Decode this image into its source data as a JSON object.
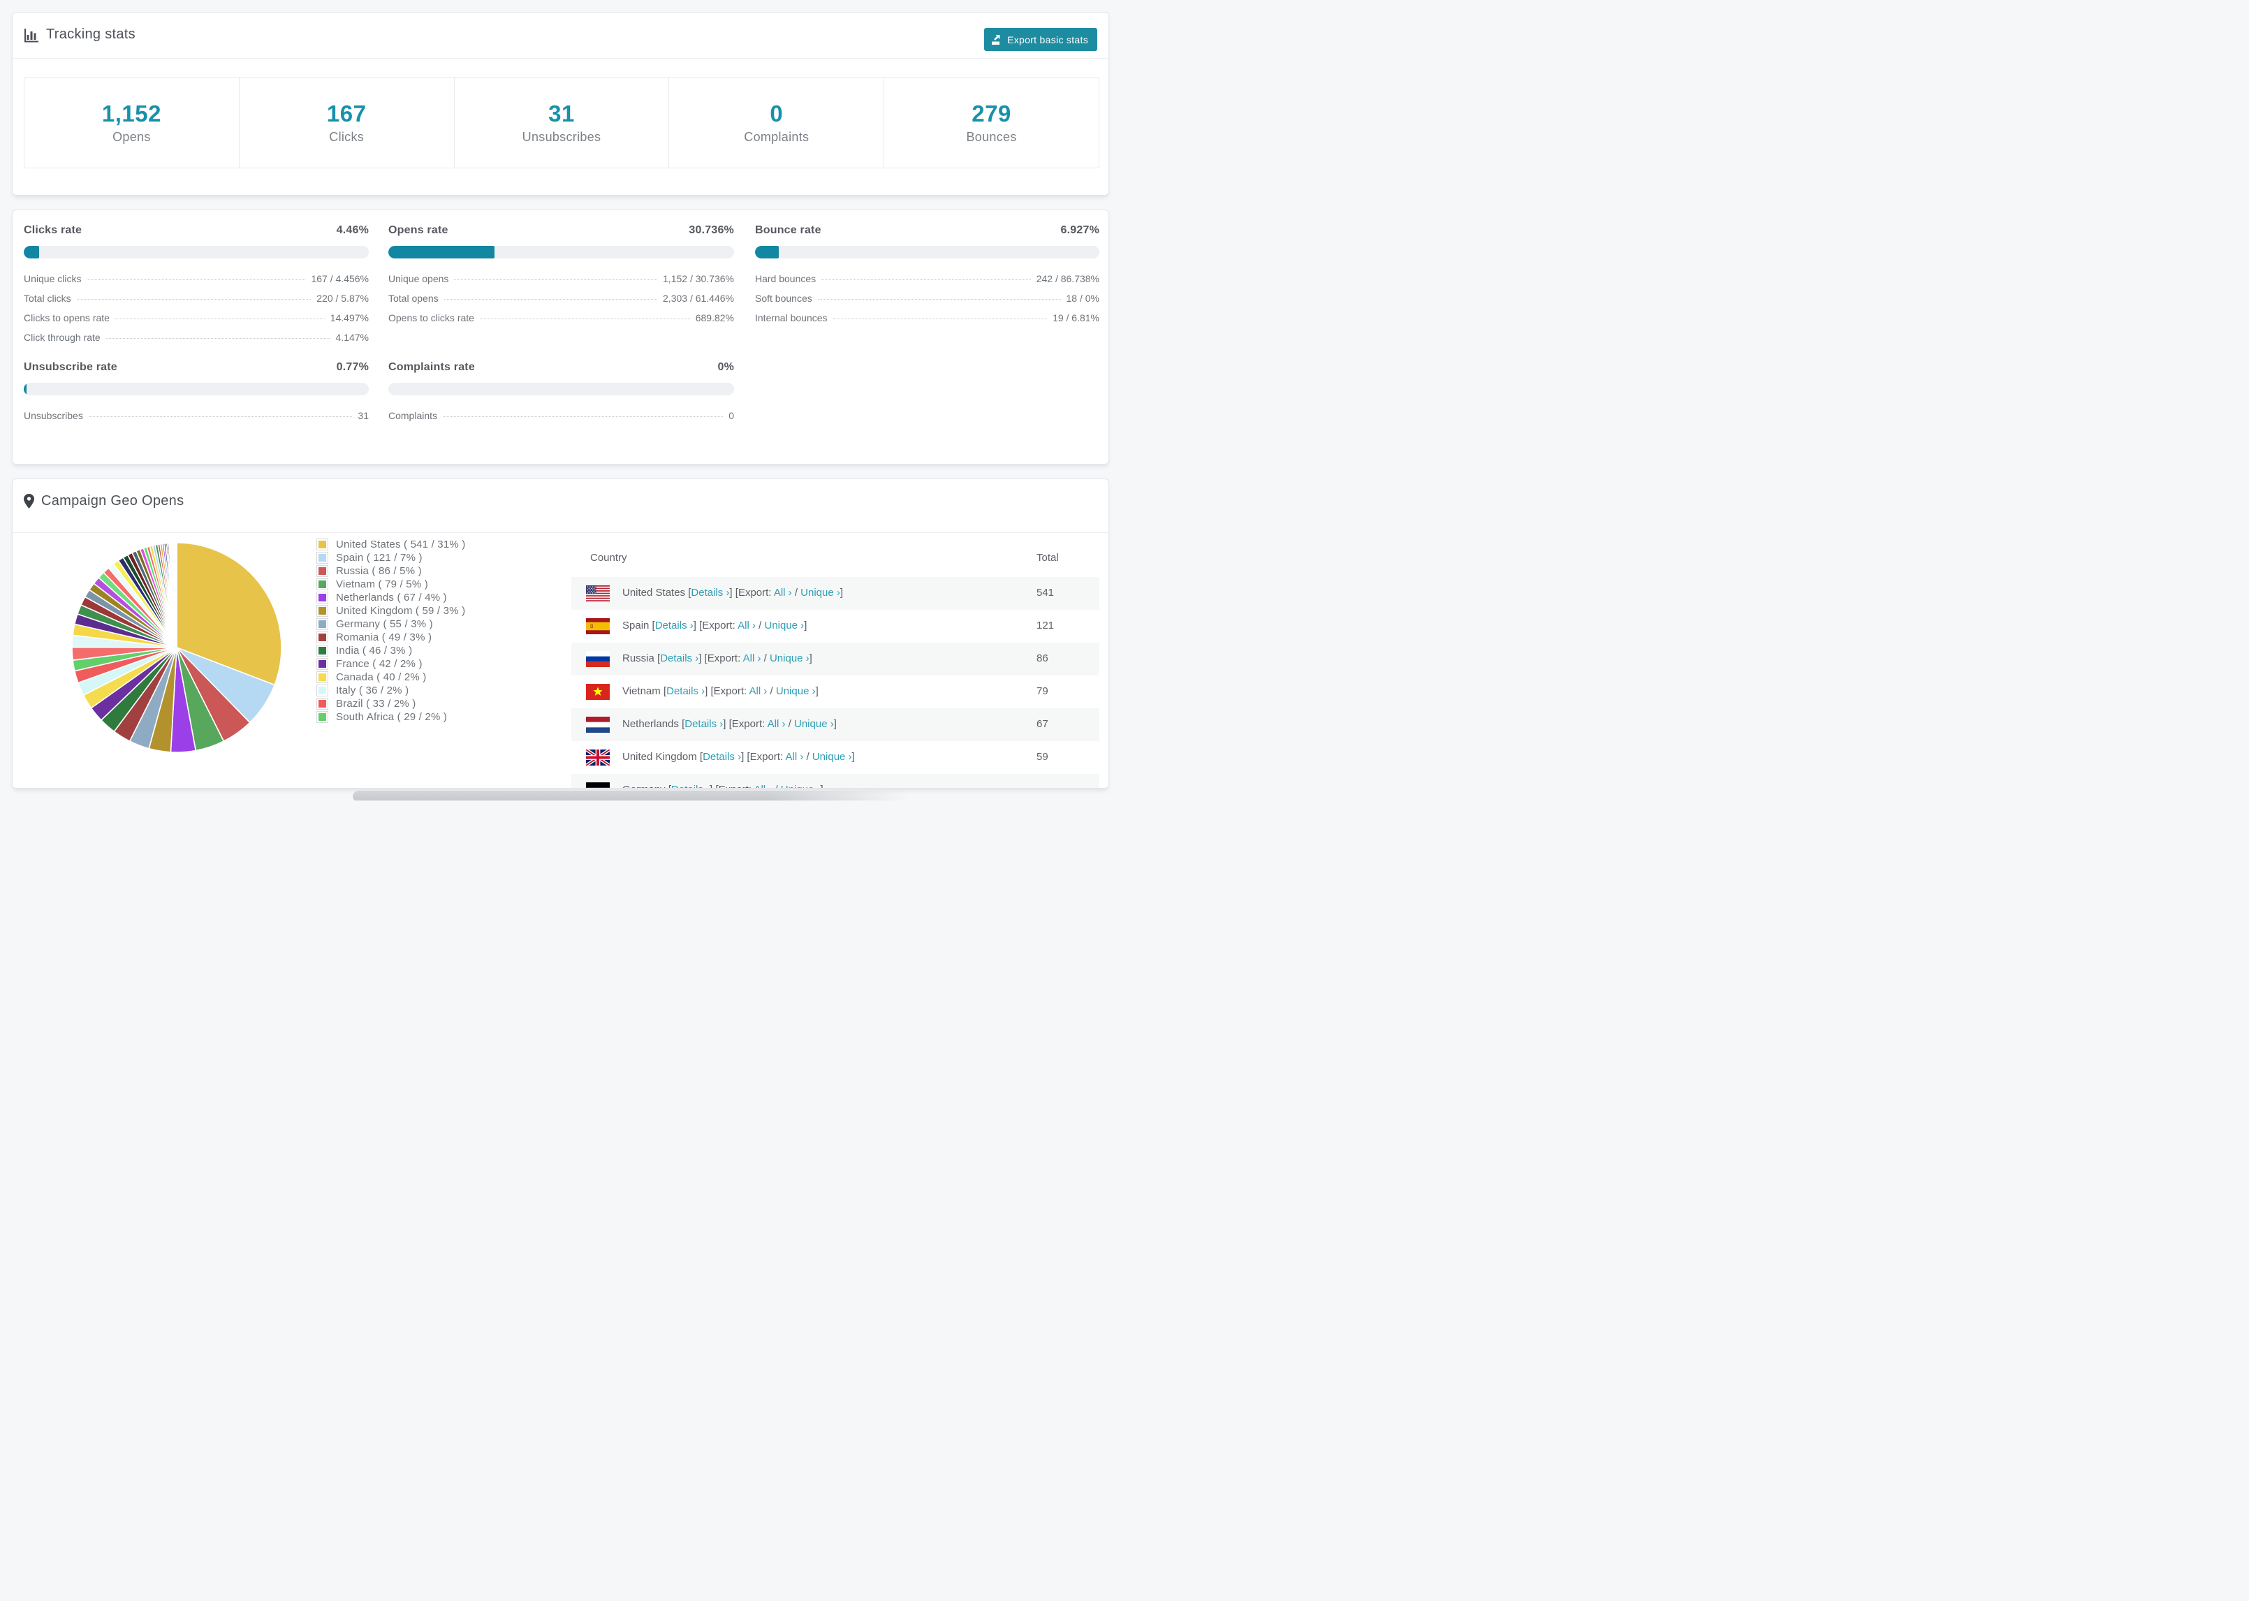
{
  "colors": {
    "accent_number": "#1791AB",
    "button_bg": "#1D8CA1",
    "link": "#2E9FB5",
    "bar_fill": "#1187A2",
    "bar_track": "#EEF0F3",
    "page_bg": "#F6F7F8"
  },
  "tracking": {
    "title": "Tracking stats",
    "export_button": "Export basic stats",
    "stats": [
      {
        "value": "1,152",
        "label": "Opens"
      },
      {
        "value": "167",
        "label": "Clicks"
      },
      {
        "value": "31",
        "label": "Unsubscribes"
      },
      {
        "value": "0",
        "label": "Complaints"
      },
      {
        "value": "279",
        "label": "Bounces"
      }
    ]
  },
  "rates": [
    {
      "title": "Clicks rate",
      "value": "4.46%",
      "bar_pct": 4.46,
      "rows": [
        {
          "label": "Unique clicks",
          "value": "167 / 4.456%"
        },
        {
          "label": "Total clicks",
          "value": "220 / 5.87%"
        },
        {
          "label": "Clicks to opens rate",
          "value": "14.497%"
        },
        {
          "label": "Click through rate",
          "value": "4.147%"
        }
      ]
    },
    {
      "title": "Opens rate",
      "value": "30.736%",
      "bar_pct": 30.736,
      "rows": [
        {
          "label": "Unique opens",
          "value": "1,152 / 30.736%"
        },
        {
          "label": "Total opens",
          "value": "2,303 / 61.446%"
        },
        {
          "label": "Opens to clicks rate",
          "value": "689.82%"
        }
      ]
    },
    {
      "title": "Bounce rate",
      "value": "6.927%",
      "bar_pct": 6.927,
      "rows": [
        {
          "label": "Hard bounces",
          "value": "242 / 86.738%"
        },
        {
          "label": "Soft bounces",
          "value": "18 / 0%"
        },
        {
          "label": "Internal bounces",
          "value": "19 / 6.81%"
        }
      ]
    },
    {
      "title": "Unsubscribe rate",
      "value": "0.77%",
      "bar_pct": 0.77,
      "rows": [
        {
          "label": "Unsubscribes",
          "value": "31"
        }
      ]
    },
    {
      "title": "Complaints rate",
      "value": "0%",
      "bar_pct": 0,
      "rows": [
        {
          "label": "Complaints",
          "value": "0"
        }
      ]
    }
  ],
  "geo": {
    "title": "Campaign Geo Opens",
    "table_headers": {
      "country": "Country",
      "total": "Total"
    },
    "links": {
      "details": "Details ›",
      "export_prefix": "Export:",
      "all": "All ›",
      "unique": "Unique ›",
      "open_bracket": "[",
      "close_bracket": "]",
      "slash": " / "
    },
    "countries": [
      {
        "name": "United States",
        "flag": "us",
        "total": "541"
      },
      {
        "name": "Spain",
        "flag": "es",
        "total": "121"
      },
      {
        "name": "Russia",
        "flag": "ru",
        "total": "86"
      },
      {
        "name": "Vietnam",
        "flag": "vn",
        "total": "79"
      },
      {
        "name": "Netherlands",
        "flag": "nl",
        "total": "67"
      },
      {
        "name": "United Kingdom",
        "flag": "gb",
        "total": "59"
      },
      {
        "name": "Germany",
        "flag": "de",
        "total": ""
      }
    ],
    "legend": [
      {
        "label": "United States ( 541 / 31% )",
        "color": "#E8C34A"
      },
      {
        "label": "Spain ( 121 / 7% )",
        "color": "#B5D9F2"
      },
      {
        "label": "Russia ( 86 / 5% )",
        "color": "#CC5757"
      },
      {
        "label": "Vietnam ( 79 / 5% )",
        "color": "#57A85C"
      },
      {
        "label": "Netherlands ( 67 / 4% )",
        "color": "#9B3FE8"
      },
      {
        "label": "United Kingdom ( 59 / 3% )",
        "color": "#B3922E"
      },
      {
        "label": "Germany ( 55 / 3% )",
        "color": "#8FABC4"
      },
      {
        "label": "Romania ( 49 / 3% )",
        "color": "#A04040"
      },
      {
        "label": "India ( 46 / 3% )",
        "color": "#2F7A3D"
      },
      {
        "label": "France ( 42 / 2% )",
        "color": "#6B2FA0"
      },
      {
        "label": "Canada ( 40 / 2% )",
        "color": "#F5DC4E"
      },
      {
        "label": "Italy ( 36 / 2% )",
        "color": "#D6F7F7"
      },
      {
        "label": "Brazil ( 33 / 2% )",
        "color": "#F05C5C"
      },
      {
        "label": "South Africa ( 29 / 2% )",
        "color": "#63CF6B"
      }
    ],
    "chart_data": {
      "type": "pie",
      "title": "Campaign Geo Opens",
      "legend_position": "right",
      "labels": [
        "United States",
        "Spain",
        "Russia",
        "Vietnam",
        "Netherlands",
        "United Kingdom",
        "Germany",
        "Romania",
        "India",
        "France",
        "Canada",
        "Italy",
        "Brazil",
        "South Africa"
      ],
      "values": [
        541,
        121,
        86,
        79,
        67,
        59,
        55,
        49,
        46,
        42,
        40,
        36,
        33,
        29
      ],
      "percents": [
        "31%",
        "7%",
        "5%",
        "5%",
        "4%",
        "3%",
        "3%",
        "3%",
        "3%",
        "2%",
        "2%",
        "2%",
        "2%",
        "2%"
      ],
      "colors": [
        "#E8C34A",
        "#B5D9F2",
        "#CC5757",
        "#57A85C",
        "#9B3FE8",
        "#B3922E",
        "#8FABC4",
        "#A04040",
        "#2F7A3D",
        "#6B2FA0",
        "#F5DC4E",
        "#D6F7F7",
        "#F05C5C",
        "#63CF6B"
      ],
      "others_note": "tail of unlabeled small country slices, drawn clockwise after the named slices",
      "others_values": [
        35,
        32,
        30,
        28,
        26,
        24,
        22,
        21,
        20,
        19,
        18,
        17,
        16,
        15,
        14,
        13,
        12,
        11,
        10,
        9,
        8,
        8,
        7,
        7,
        6,
        6,
        5,
        5,
        4,
        4,
        3,
        3,
        2,
        2,
        2,
        1,
        1,
        1,
        1,
        1,
        1,
        1,
        1,
        1
      ],
      "others_colors": [
        "#F56C6C",
        "#DFF7F7",
        "#F5D848",
        "#5B2D8E",
        "#3F8F4F",
        "#9C3838",
        "#7D93A8",
        "#9C8424",
        "#B44FE0",
        "#6EDE7A",
        "#F56C6C",
        "#ECFBFB",
        "#F5EF52",
        "#2D2D72",
        "#174F2A",
        "#6E2424",
        "#4F6878",
        "#7D6E1D",
        "#E04FE0",
        "#5BE06E",
        "#F56C6C",
        "#F5D848",
        "#A8D3F0",
        "#3F8F4F",
        "#D64545",
        "#D4AF37",
        "#8A4FE0",
        "#2D2D7A",
        "#1F5C33",
        "#7A2A2A",
        "#5C7A8A",
        "#8A7A1F",
        "#C44FD6",
        "#5BE06E",
        "#FF6EC7",
        "#E8A23C",
        "#A8D3F0",
        "#57A85C",
        "#D64545",
        "#C9A227",
        "#8A4FE0",
        "#4A2D8A",
        "#2F6E3A",
        "#8A3030"
      ]
    }
  }
}
